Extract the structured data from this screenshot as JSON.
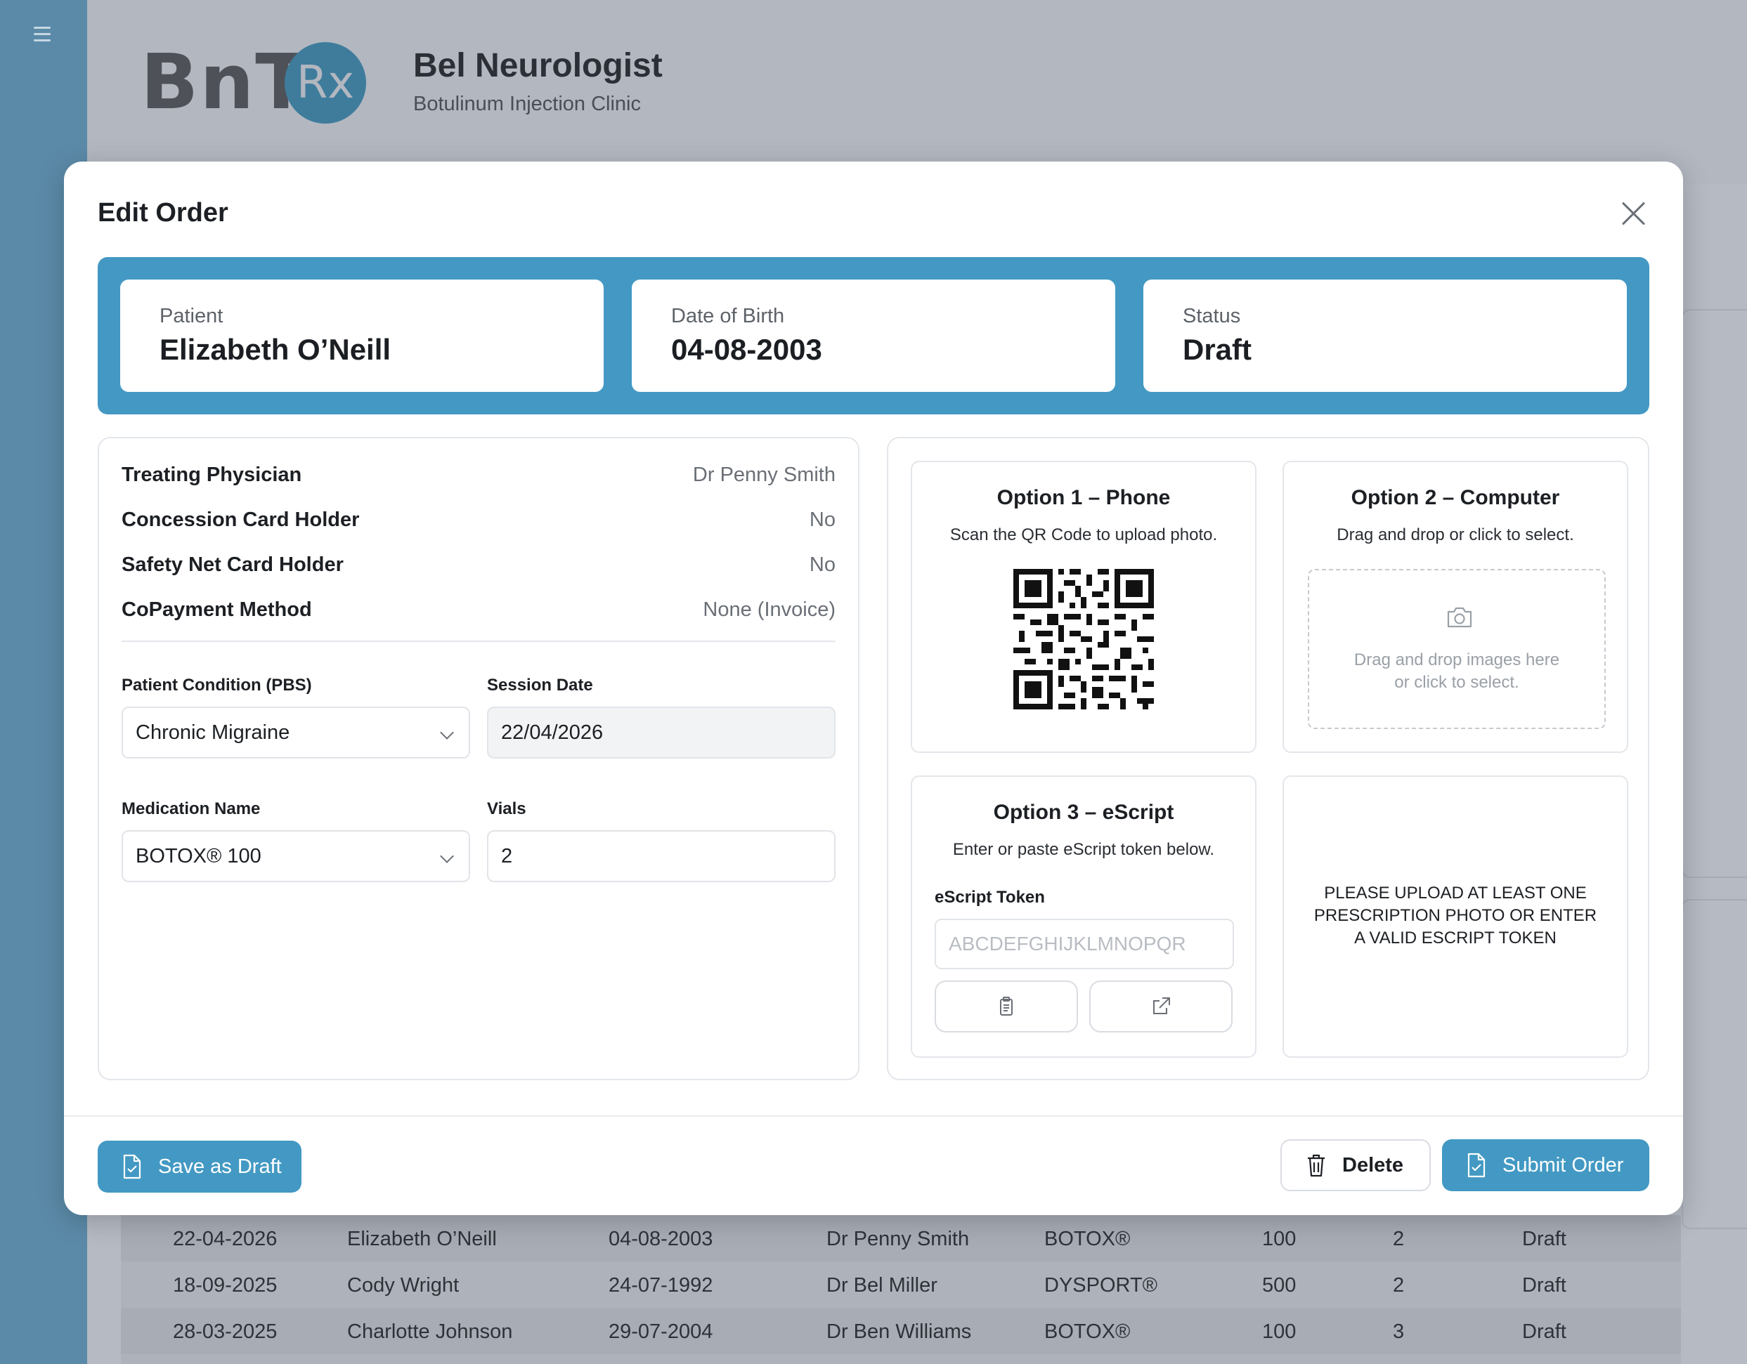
{
  "app": {
    "logo_text": "BnT",
    "logo_badge": "Rx",
    "clinic_name": "Bel Neurologist",
    "clinic_subtitle": "Botulinum Injection Clinic"
  },
  "background_table": {
    "rows": [
      [
        "22-04-2026",
        "Elizabeth O’Neill",
        "04-08-2003",
        "Dr Penny Smith",
        "BOTOX®",
        "100",
        "2",
        "Draft"
      ],
      [
        "18-09-2025",
        "Cody Wright",
        "24-07-1992",
        "Dr Bel Miller",
        "DYSPORT®",
        "500",
        "2",
        "Draft"
      ],
      [
        "28-03-2025",
        "Charlotte Johnson",
        "29-07-2004",
        "Dr Ben Williams",
        "BOTOX®",
        "100",
        "3",
        "Draft"
      ]
    ]
  },
  "modal": {
    "title": "Edit Order",
    "patient_label": "Patient",
    "patient_value": "Elizabeth O’Neill",
    "dob_label": "Date of Birth",
    "dob_value": "04-08-2003",
    "status_label": "Status",
    "status_value": "Draft",
    "details": [
      {
        "key": "Treating Physician",
        "value": "Dr Penny Smith"
      },
      {
        "key": "Concession Card Holder",
        "value": "No"
      },
      {
        "key": "Safety Net Card Holder",
        "value": "No"
      },
      {
        "key": "CoPayment Method",
        "value": "None (Invoice)"
      }
    ],
    "condition_label": "Patient Condition (PBS)",
    "condition_value": "Chronic Migraine",
    "session_label": "Session Date",
    "session_value": "22/04/2026",
    "medication_label": "Medication Name",
    "medication_value": "BOTOX® 100",
    "vials_label": "Vials",
    "vials_value": "2",
    "option1_title": "Option 1 – Phone",
    "option1_sub": "Scan the QR Code to upload photo.",
    "option2_title": "Option 2 – Computer",
    "option2_sub": "Drag and drop or click to select.",
    "dropzone_line1": "Drag and drop images here",
    "dropzone_line2": "or click to select.",
    "option3_title": "Option 3 – eScript",
    "option3_sub": "Enter or paste eScript token below.",
    "token_label": "eScript Token",
    "token_placeholder": "ABCDEFGHIJKLMNOPQR",
    "notice": "Please upload at least one prescription photo or enter a valid eScript token",
    "save_draft": "Save as Draft",
    "delete": "Delete",
    "submit": "Submit Order"
  },
  "colors": {
    "accent": "#4399c3",
    "sidebar": "#5b8aa8"
  },
  "icons": [
    "menu-icon",
    "close-icon",
    "camera-icon",
    "clipboard-icon",
    "external-link-icon",
    "file-check-icon",
    "trash-icon",
    "qr-code-icon"
  ]
}
